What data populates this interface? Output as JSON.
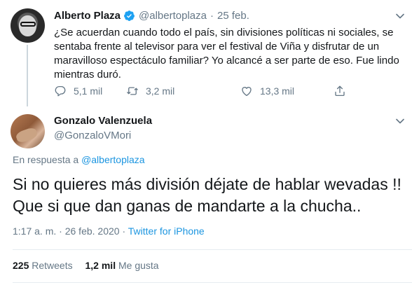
{
  "parent_tweet": {
    "author_name": "Alberto Plaza",
    "handle": "@albertoplaza",
    "separator": "·",
    "date": "25 feb.",
    "text": "¿Se acuerdan cuando todo el país, sin divisiones políticas ni sociales, se sentaba frente al televisor para ver el festival de Viña y disfrutar de un maravilloso espectáculo familiar? Yo alcancé a ser parte de eso. Fue lindo mientras duró.",
    "replies": "5,1 mil",
    "retweets": "3,2 mil",
    "likes": "13,3 mil",
    "icons": [
      "verified-badge-icon",
      "chevron-down-icon",
      "reply-icon",
      "retweet-icon",
      "heart-icon",
      "share-icon"
    ]
  },
  "main_tweet": {
    "author_name": "Gonzalo Valenzuela",
    "handle": "@GonzaloVMori",
    "reply_prefix": "En respuesta a",
    "reply_handle": "@albertoplaza",
    "text": "Si no quieres más división déjate de hablar wevadas !! Que si que dan ganas de mandarte a la chucha..",
    "time": "1:17 a. m.",
    "dot": "·",
    "date": "26 feb. 2020",
    "source": "Twitter for iPhone",
    "retweets_count": "225",
    "retweets_label": "Retweets",
    "likes_count": "1,2 mil",
    "likes_label": "Me gusta"
  },
  "colors": {
    "accent": "#1da1f2",
    "link": "#1b95e0",
    "muted": "#657786",
    "text": "#14171a",
    "divider": "#e6ecf0"
  }
}
